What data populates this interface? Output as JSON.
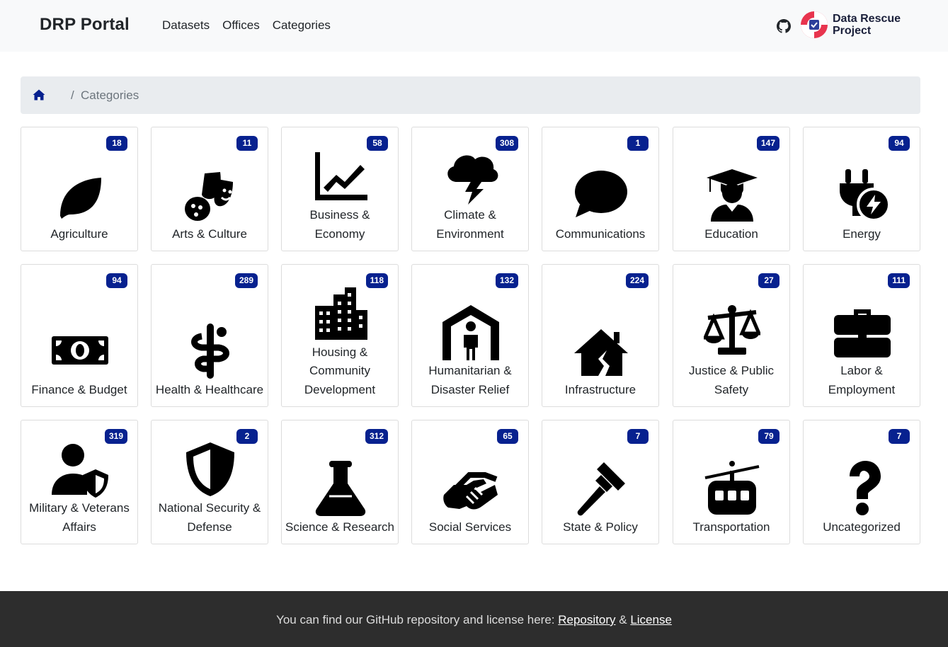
{
  "navbar": {
    "brand": "DRP Portal",
    "links": [
      "Datasets",
      "Offices",
      "Categories"
    ],
    "github_icon": "github-icon",
    "logo_text_line1": "Data Rescue",
    "logo_text_line2": "Project"
  },
  "breadcrumb": {
    "home_icon": "home-icon",
    "separator": "/",
    "current": "Categories"
  },
  "categories": [
    {
      "label": "Agriculture",
      "count": "18",
      "icon": "leaf-icon"
    },
    {
      "label": "Arts & Culture",
      "count": "11",
      "icon": "theater-masks-icon"
    },
    {
      "label": "Business & Economy",
      "count": "58",
      "icon": "line-chart-icon"
    },
    {
      "label": "Climate & Environment",
      "count": "308",
      "icon": "storm-cloud-icon"
    },
    {
      "label": "Communications",
      "count": "1",
      "icon": "speech-bubble-icon"
    },
    {
      "label": "Education",
      "count": "147",
      "icon": "graduate-icon"
    },
    {
      "label": "Energy",
      "count": "94",
      "icon": "plug-bolt-icon"
    },
    {
      "label": "Finance & Budget",
      "count": "94",
      "icon": "money-bill-icon"
    },
    {
      "label": "Health & Healthcare",
      "count": "289",
      "icon": "staff-snake-icon"
    },
    {
      "label": "Housing & Community Development",
      "count": "118",
      "icon": "city-icon"
    },
    {
      "label": "Humanitarian & Disaster Relief",
      "count": "132",
      "icon": "person-shelter-icon"
    },
    {
      "label": "Infrastructure",
      "count": "224",
      "icon": "house-crack-icon"
    },
    {
      "label": "Justice & Public Safety",
      "count": "27",
      "icon": "scale-icon"
    },
    {
      "label": "Labor & Employment",
      "count": "111",
      "icon": "briefcase-icon"
    },
    {
      "label": "Military & Veterans Affairs",
      "count": "319",
      "icon": "user-shield-icon"
    },
    {
      "label": "National Security & Defense",
      "count": "2",
      "icon": "shield-icon"
    },
    {
      "label": "Science & Research",
      "count": "312",
      "icon": "flask-icon"
    },
    {
      "label": "Social Services",
      "count": "65",
      "icon": "handshake-icon"
    },
    {
      "label": "State & Policy",
      "count": "7",
      "icon": "gavel-icon"
    },
    {
      "label": "Transportation",
      "count": "79",
      "icon": "cable-car-icon"
    },
    {
      "label": "Uncategorized",
      "count": "7",
      "icon": "question-icon"
    }
  ],
  "footer": {
    "text": "You can find our GitHub repository and license here:",
    "repo_link": "Repository",
    "amp": "&",
    "license_link": "License"
  },
  "colors": {
    "badge": "#07218f",
    "navbar_bg": "#f8f9fa",
    "breadcrumb_bg": "#e9ecef",
    "footer_bg": "#2d2d2d"
  }
}
